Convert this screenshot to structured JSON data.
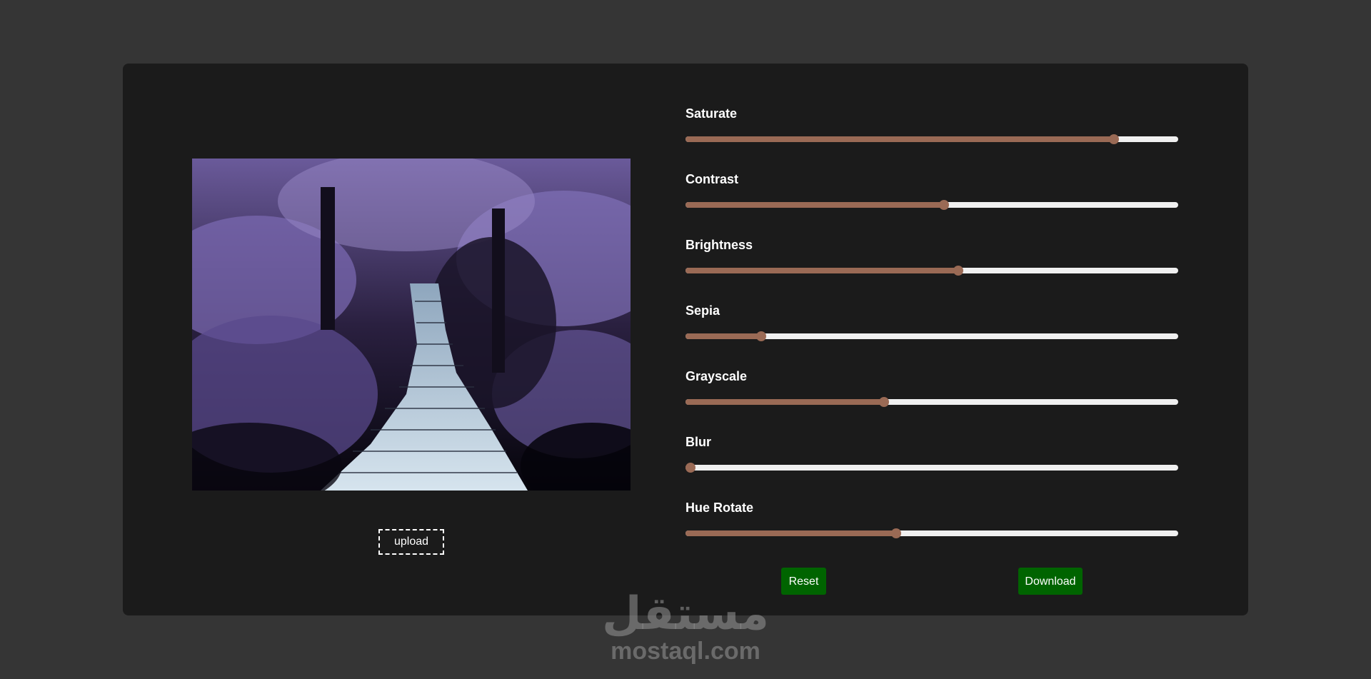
{
  "editor": {
    "upload_label": "upload",
    "reset_label": "Reset",
    "download_label": "Download",
    "accent_color": "#9a6a55",
    "button_color": "#006400"
  },
  "filters": [
    {
      "label": "Saturate",
      "value": 0.87
    },
    {
      "label": "Contrast",
      "value": 0.525
    },
    {
      "label": "Brightness",
      "value": 0.553
    },
    {
      "label": "Sepia",
      "value": 0.154
    },
    {
      "label": "Grayscale",
      "value": 0.403
    },
    {
      "label": "Blur",
      "value": 0.01
    },
    {
      "label": "Hue Rotate",
      "value": 0.427
    }
  ],
  "watermark": {
    "arabic": "مستقل",
    "latin": "mostaql.com"
  }
}
